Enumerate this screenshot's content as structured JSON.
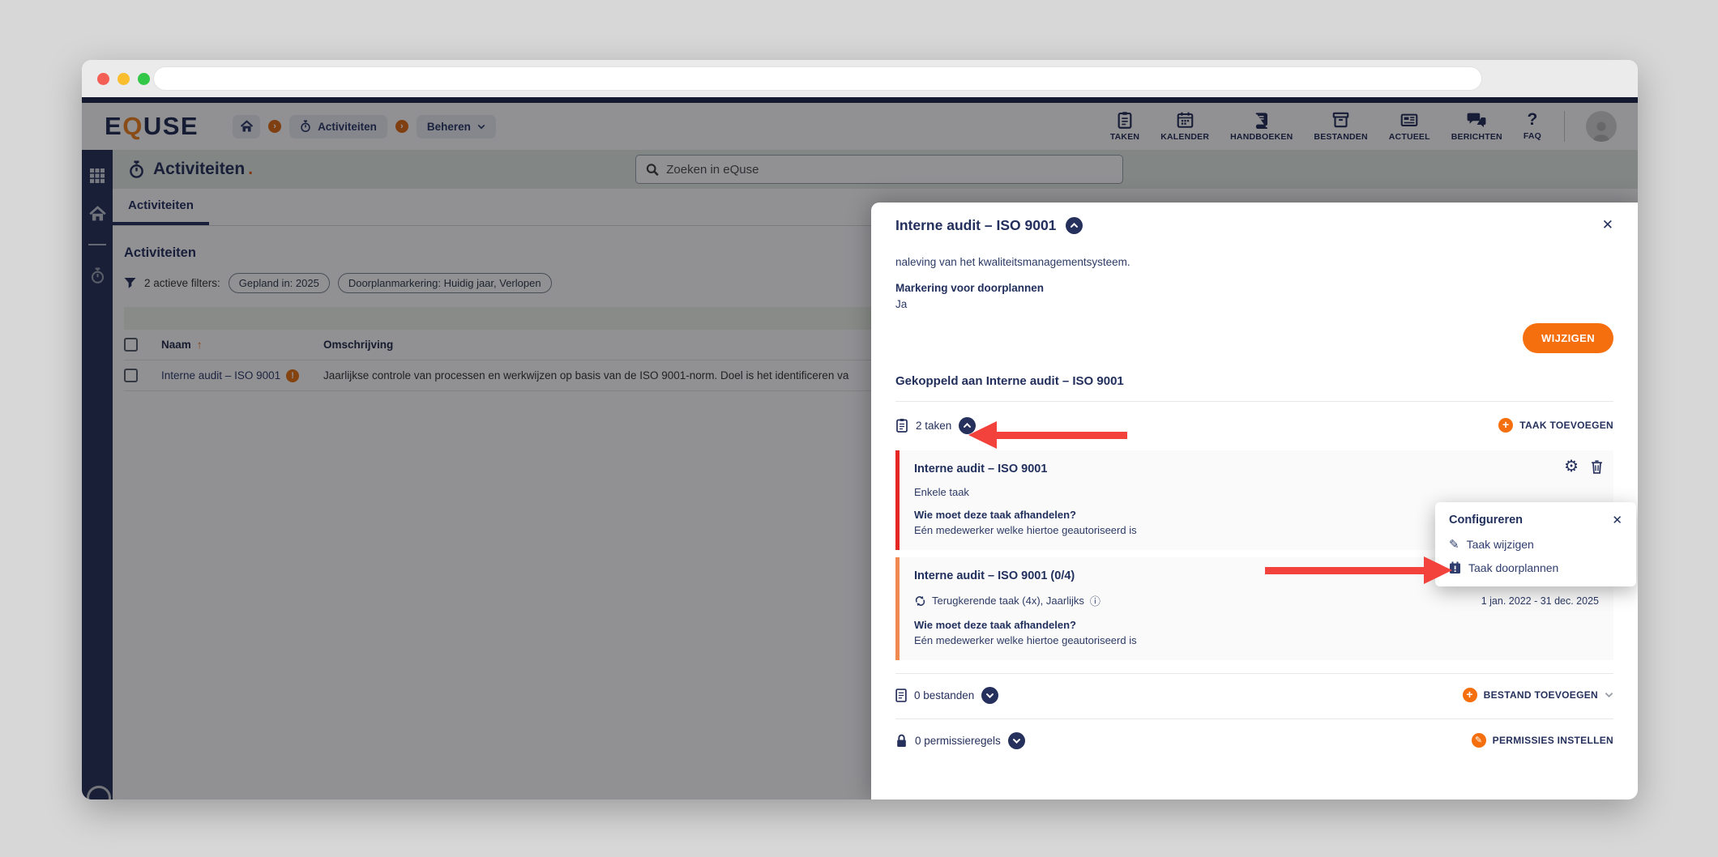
{
  "colors": {
    "navy": "#25305c",
    "navy_dark": "#222f5c",
    "orange": "#f56f0e",
    "orange_logo": "#f0821a",
    "arrow_red": "#f2423b",
    "card_border_red": "#e52823",
    "card_border_orange": "#f18a50",
    "sidebar_bg": "#253057",
    "title_row_bg": "#e4ebe4",
    "toolbar_strip_bg": "#eff5ea"
  },
  "icons_glyphs": {
    "close": "✕",
    "pencil": "✎",
    "gear": "⚙",
    "info": "ⓘ",
    "sort_up": "↑",
    "exclamation": "!",
    "faq": "?",
    "plus": "+",
    "crumb_arrow": "›"
  },
  "browser": {
    "url": ""
  },
  "header": {
    "logo": {
      "e": "E",
      "q": "Q",
      "use": "USE"
    },
    "breadcrumb": {
      "level1": "Activiteiten",
      "level2": "Beheren"
    },
    "nav": [
      {
        "label": "TAKEN",
        "icon": "clipboard-icon"
      },
      {
        "label": "KALENDER",
        "icon": "calendar-icon"
      },
      {
        "label": "HANDBOEKEN",
        "icon": "book-icon"
      },
      {
        "label": "BESTANDEN",
        "icon": "archive-icon"
      },
      {
        "label": "ACTUEEL",
        "icon": "news-icon"
      },
      {
        "label": "BERICHTEN",
        "icon": "chat-icon"
      },
      {
        "label": "FAQ",
        "icon": "question-icon"
      }
    ]
  },
  "page": {
    "title": "Activiteiten",
    "title_dot": ".",
    "search_placeholder": "Zoeken in eQuse",
    "tab": "Activiteiten",
    "section_heading": "Activiteiten",
    "filters": {
      "label": "2 actieve filters:",
      "chips": [
        "Gepland in: 2025",
        "Doorplanmarkering: Huidig jaar, Verlopen"
      ]
    },
    "table": {
      "col_name": "Naam",
      "col_desc": "Omschrijving",
      "rows": [
        {
          "name": "Interne audit – ISO 9001",
          "description": "Jaarlijkse controle van processen en werkwijzen op basis van de ISO 9001-norm. Doel is het identificeren va"
        }
      ]
    }
  },
  "modal": {
    "title": "Interne audit – ISO 9001",
    "body_text": "naleving van het kwaliteitsmanagementsysteem.",
    "marking_label": "Markering voor doorplannen",
    "marking_value": "Ja",
    "edit_button": "WIJZIGEN",
    "linked_heading": "Gekoppeld aan Interne audit – ISO 9001",
    "tasks_count": "2 taken",
    "add_task": "TAAK TOEVOEGEN",
    "tasks": [
      {
        "title": "Interne audit – ISO 9001",
        "type": "Enkele taak",
        "question": "Wie moet deze taak afhandelen?",
        "answer": "Eén medewerker welke hiertoe geautoriseerd is"
      },
      {
        "title": "Interne audit – ISO 9001 (0/4)",
        "recurrence": "Terugkerende taak (4x), Jaarlijks",
        "period": "1 jan. 2022 - 31 dec. 2025",
        "question": "Wie moet deze taak afhandelen?",
        "answer": "Eén medewerker welke hiertoe geautoriseerd is"
      }
    ],
    "files_count": "0 bestanden",
    "add_file": "BESTAND TOEVOEGEN",
    "permissions_count": "0 permissieregels",
    "set_permissions": "PERMISSIES INSTELLEN"
  },
  "popup": {
    "title": "Configureren",
    "items": [
      "Taak wijzigen",
      "Taak doorplannen"
    ]
  }
}
